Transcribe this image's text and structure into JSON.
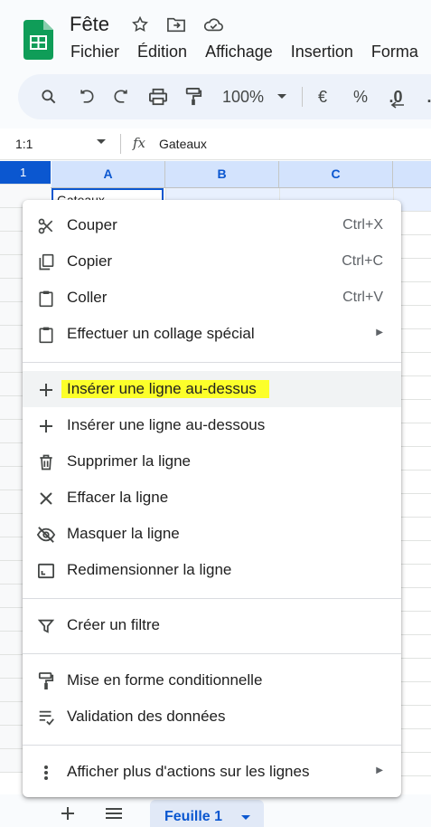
{
  "doc": {
    "title": "Fête"
  },
  "menubar": [
    "Fichier",
    "Édition",
    "Affichage",
    "Insertion",
    "Forma"
  ],
  "toolbar": {
    "zoom": "100%",
    "currency": "€",
    "percent": "%",
    "dec_decrease": ".0",
    "dec_increase": ".0"
  },
  "formula_bar": {
    "name_box": "1:1",
    "fx": "fx",
    "value": "Gateaux"
  },
  "grid": {
    "columns": [
      "A",
      "B",
      "C"
    ],
    "selected_row": "1",
    "cell_a1": "Gateaux"
  },
  "context_menu": {
    "items": [
      {
        "label": "Couper",
        "shortcut": "Ctrl+X",
        "icon": "scissors-icon"
      },
      {
        "label": "Copier",
        "shortcut": "Ctrl+C",
        "icon": "copy-icon"
      },
      {
        "label": "Coller",
        "shortcut": "Ctrl+V",
        "icon": "paste-icon"
      },
      {
        "label": "Effectuer un collage spécial",
        "icon": "paste-special-icon",
        "submenu": true
      },
      {
        "label": "Insérer une ligne au-dessus",
        "icon": "plus-icon",
        "highlighted": true
      },
      {
        "label": "Insérer une ligne au-dessous",
        "icon": "plus-icon"
      },
      {
        "label": "Supprimer la ligne",
        "icon": "trash-icon"
      },
      {
        "label": "Effacer la ligne",
        "icon": "close-icon"
      },
      {
        "label": "Masquer la ligne",
        "icon": "eye-off-icon"
      },
      {
        "label": "Redimensionner la ligne",
        "icon": "resize-icon"
      },
      {
        "label": "Créer un filtre",
        "icon": "filter-icon"
      },
      {
        "label": "Mise en forme conditionnelle",
        "icon": "paint-roller-icon"
      },
      {
        "label": "Validation des données",
        "icon": "data-validation-icon"
      },
      {
        "label": "Afficher plus d'actions sur les lignes",
        "icon": "more-vert-icon",
        "submenu": true
      }
    ]
  },
  "sheet_bar": {
    "active_sheet": "Feuille 1"
  },
  "colors": {
    "accent": "#0b57d0",
    "highlight": "#fcff2a",
    "logo_green": "#0f9d58"
  }
}
